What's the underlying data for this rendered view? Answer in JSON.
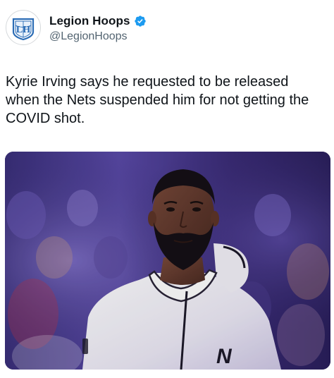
{
  "account": {
    "display_name": "Legion Hoops",
    "handle": "@LegionHoops",
    "verified": true,
    "verified_color": "#1d9bf0",
    "avatar_icon": "legion-hoops-logo-icon",
    "avatar_logo_text": "LH"
  },
  "tweet": {
    "text": "Kyrie Irving says he requested to be released\nwhen the Nets suspended him for not getting the\nCOVID shot."
  },
  "media": {
    "type": "photo",
    "jersey_letter": "N"
  },
  "colors": {
    "text_primary": "#0f1419",
    "text_secondary": "#536471",
    "brand_blue": "#1d9bf0",
    "logo_blue": "#2b6cb5"
  }
}
